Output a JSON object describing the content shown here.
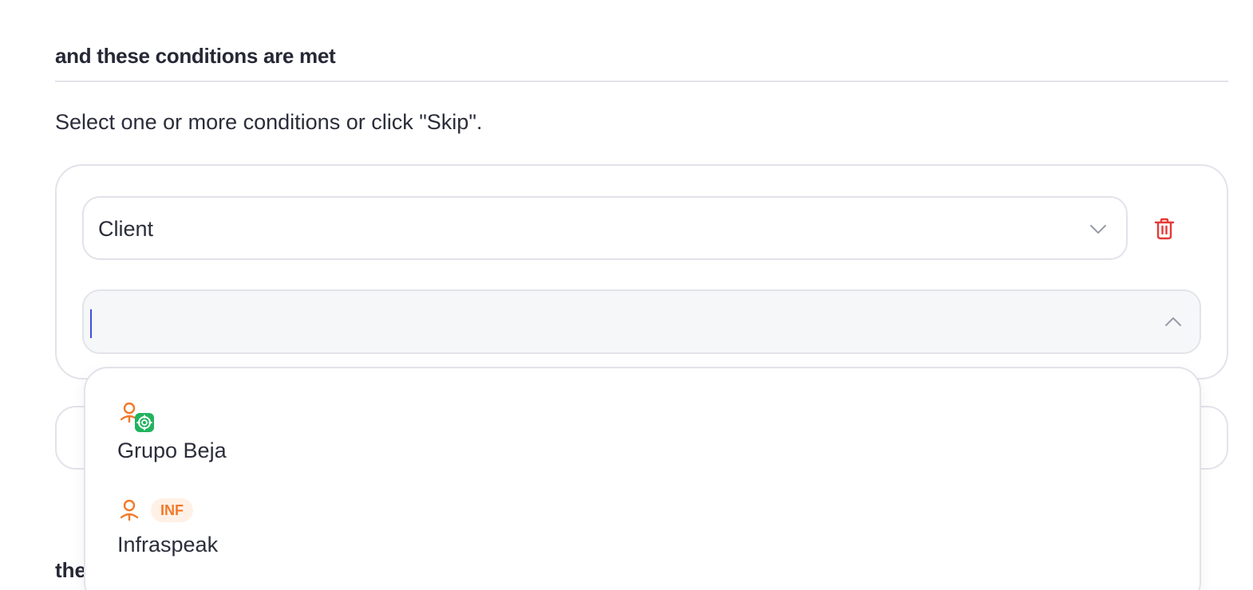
{
  "section": {
    "title": "and these conditions are met",
    "instructions": "Select one or more conditions or click \"Skip\"."
  },
  "condition": {
    "field_value": "Client",
    "search_value": "",
    "delete_icon": "trash-icon"
  },
  "dropdown": {
    "options": [
      {
        "label": "Grupo Beja",
        "icon": "client-icon",
        "badge_icon": "target-icon"
      },
      {
        "label": "Infraspeak",
        "icon": "client-icon",
        "badge": "INF"
      }
    ]
  },
  "next_section": {
    "title_partial": "the"
  },
  "colors": {
    "accent": "#f2792b",
    "danger": "#e53935",
    "green": "#22b35e",
    "caret": "#3b4fd8"
  }
}
